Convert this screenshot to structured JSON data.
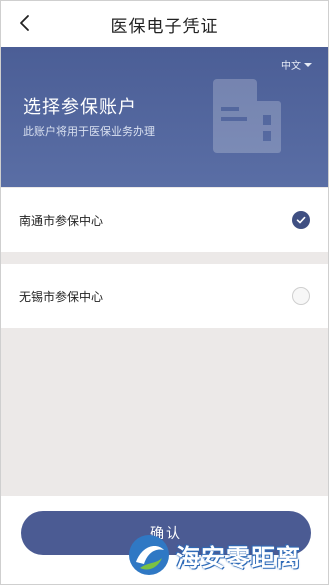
{
  "navbar": {
    "title": "医保电子凭证",
    "back_icon": "chevron-left-icon"
  },
  "banner": {
    "language": "中文",
    "title": "选择参保账户",
    "subtitle": "此账户将用于医保业务办理",
    "colors": {
      "accent": "#4b5e96"
    }
  },
  "accounts": [
    {
      "label": "南通市参保中心",
      "selected": true
    },
    {
      "label": "无锡市参保中心",
      "selected": false
    }
  ],
  "confirm_label": "确认",
  "watermark": {
    "text": "海安零距离"
  }
}
